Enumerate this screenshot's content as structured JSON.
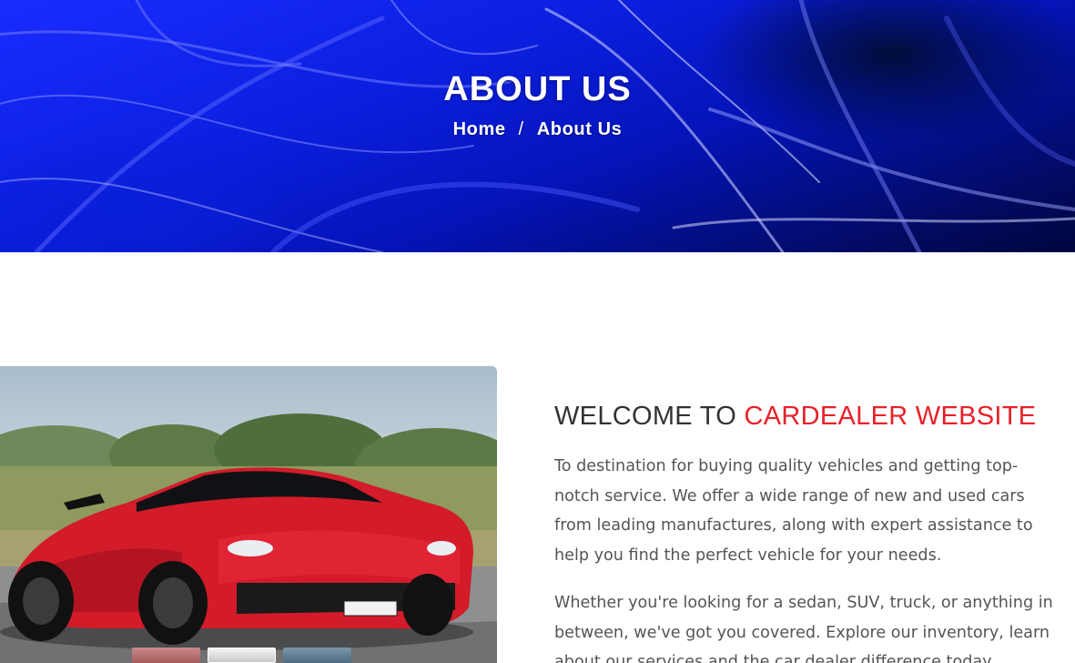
{
  "hero": {
    "title": "ABOUT US",
    "breadcrumb": {
      "home": "Home",
      "separator": "/",
      "current": "About Us"
    },
    "background": "abstract-blue-glass-image"
  },
  "about_image": {
    "subject": "red-sports-car-photo",
    "thumbnails": [
      "red-car-thumbnail",
      "white-car-thumbnail",
      "blue-car-thumbnail"
    ]
  },
  "about": {
    "heading_prefix": "WELCOME TO ",
    "heading_accent": "CARDEALER WEBSITE",
    "paragraph_1": "To destination for buying quality vehicles and getting top-notch service. We offer a wide range of new and used cars from leading manufactures, along with expert assistance to help you find the perfect vehicle for your needs.",
    "paragraph_2": "Whether you're looking for a sedan, SUV, truck, or anything in between, we've got you covered. Explore our inventory, learn about our services and the car dealer difference today."
  },
  "colors": {
    "accent": "#e8202a",
    "heading": "#333333",
    "body_text": "#555555",
    "hero_blue": "#0c1fe0"
  }
}
